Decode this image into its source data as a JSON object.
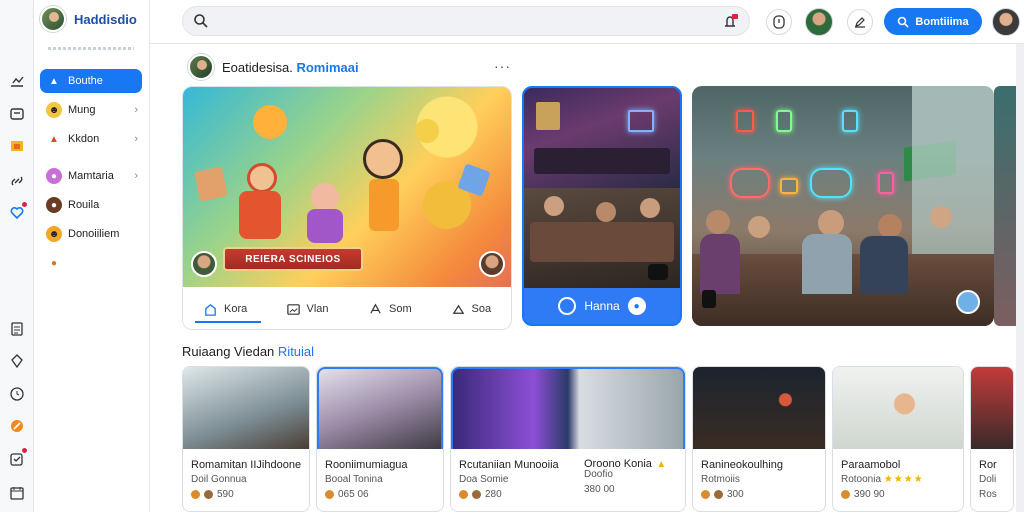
{
  "app": {
    "name": "Haddisdio",
    "accent": "#1877f2"
  },
  "rail": {
    "icons": [
      "chart-icon",
      "bookmark-icon",
      "folder-icon",
      "link-icon",
      "heart-icon",
      "document-icon",
      "compass-icon",
      "clock-icon",
      "pen-icon",
      "check-icon",
      "calendar-icon"
    ]
  },
  "nav": {
    "items": [
      {
        "label": "Bouthe",
        "icon": "flame-icon",
        "active": true
      },
      {
        "label": "Mung",
        "icon": "emoji-icon"
      },
      {
        "label": "Kkdon",
        "icon": "triangle-icon"
      },
      {
        "label": "Mamtaria",
        "icon": "planet-icon"
      },
      {
        "label": "Rouila",
        "icon": "person-icon"
      },
      {
        "label": "Donoiiliem",
        "icon": "smile-icon"
      }
    ]
  },
  "topbar": {
    "search_placeholder": "",
    "cta_label": "Bomtiiima"
  },
  "post": {
    "author": "Eoatidesisa.",
    "accent": "Romimaai",
    "more": "···"
  },
  "featured": {
    "banner": "REIERA SCINEIOS",
    "actions": [
      {
        "label": "Kora",
        "icon": "home-icon"
      },
      {
        "label": "Vlan",
        "icon": "picture-icon"
      },
      {
        "label": "Som",
        "icon": "share-icon"
      },
      {
        "label": "Soa",
        "icon": "bell-icon"
      }
    ]
  },
  "middle_card": {
    "label": "Hanna"
  },
  "section": {
    "title": "Ruiaang Viedan",
    "accent": "Rituial"
  },
  "cards": [
    {
      "title": "Romamitan IIJihdoone",
      "sub": "Doil Gonnua",
      "meta": "590"
    },
    {
      "title": "Rooniimumiagua",
      "sub": "Booal Tonina",
      "meta": "065 06"
    },
    {
      "title": "Rcutaniian Munooiia",
      "sub": "Doa Somie",
      "meta": "280"
    },
    {
      "title": "Oroono Konia",
      "sub": "Doofio",
      "meta": "380 00"
    },
    {
      "title": "Ranineokoulhing",
      "sub": "Rotmoiis",
      "meta": "300"
    },
    {
      "title": "Paraamobol",
      "sub": "Rotoonia",
      "meta": "390 90"
    },
    {
      "title": "Ror",
      "sub": "Doli",
      "meta": "Ros"
    }
  ]
}
